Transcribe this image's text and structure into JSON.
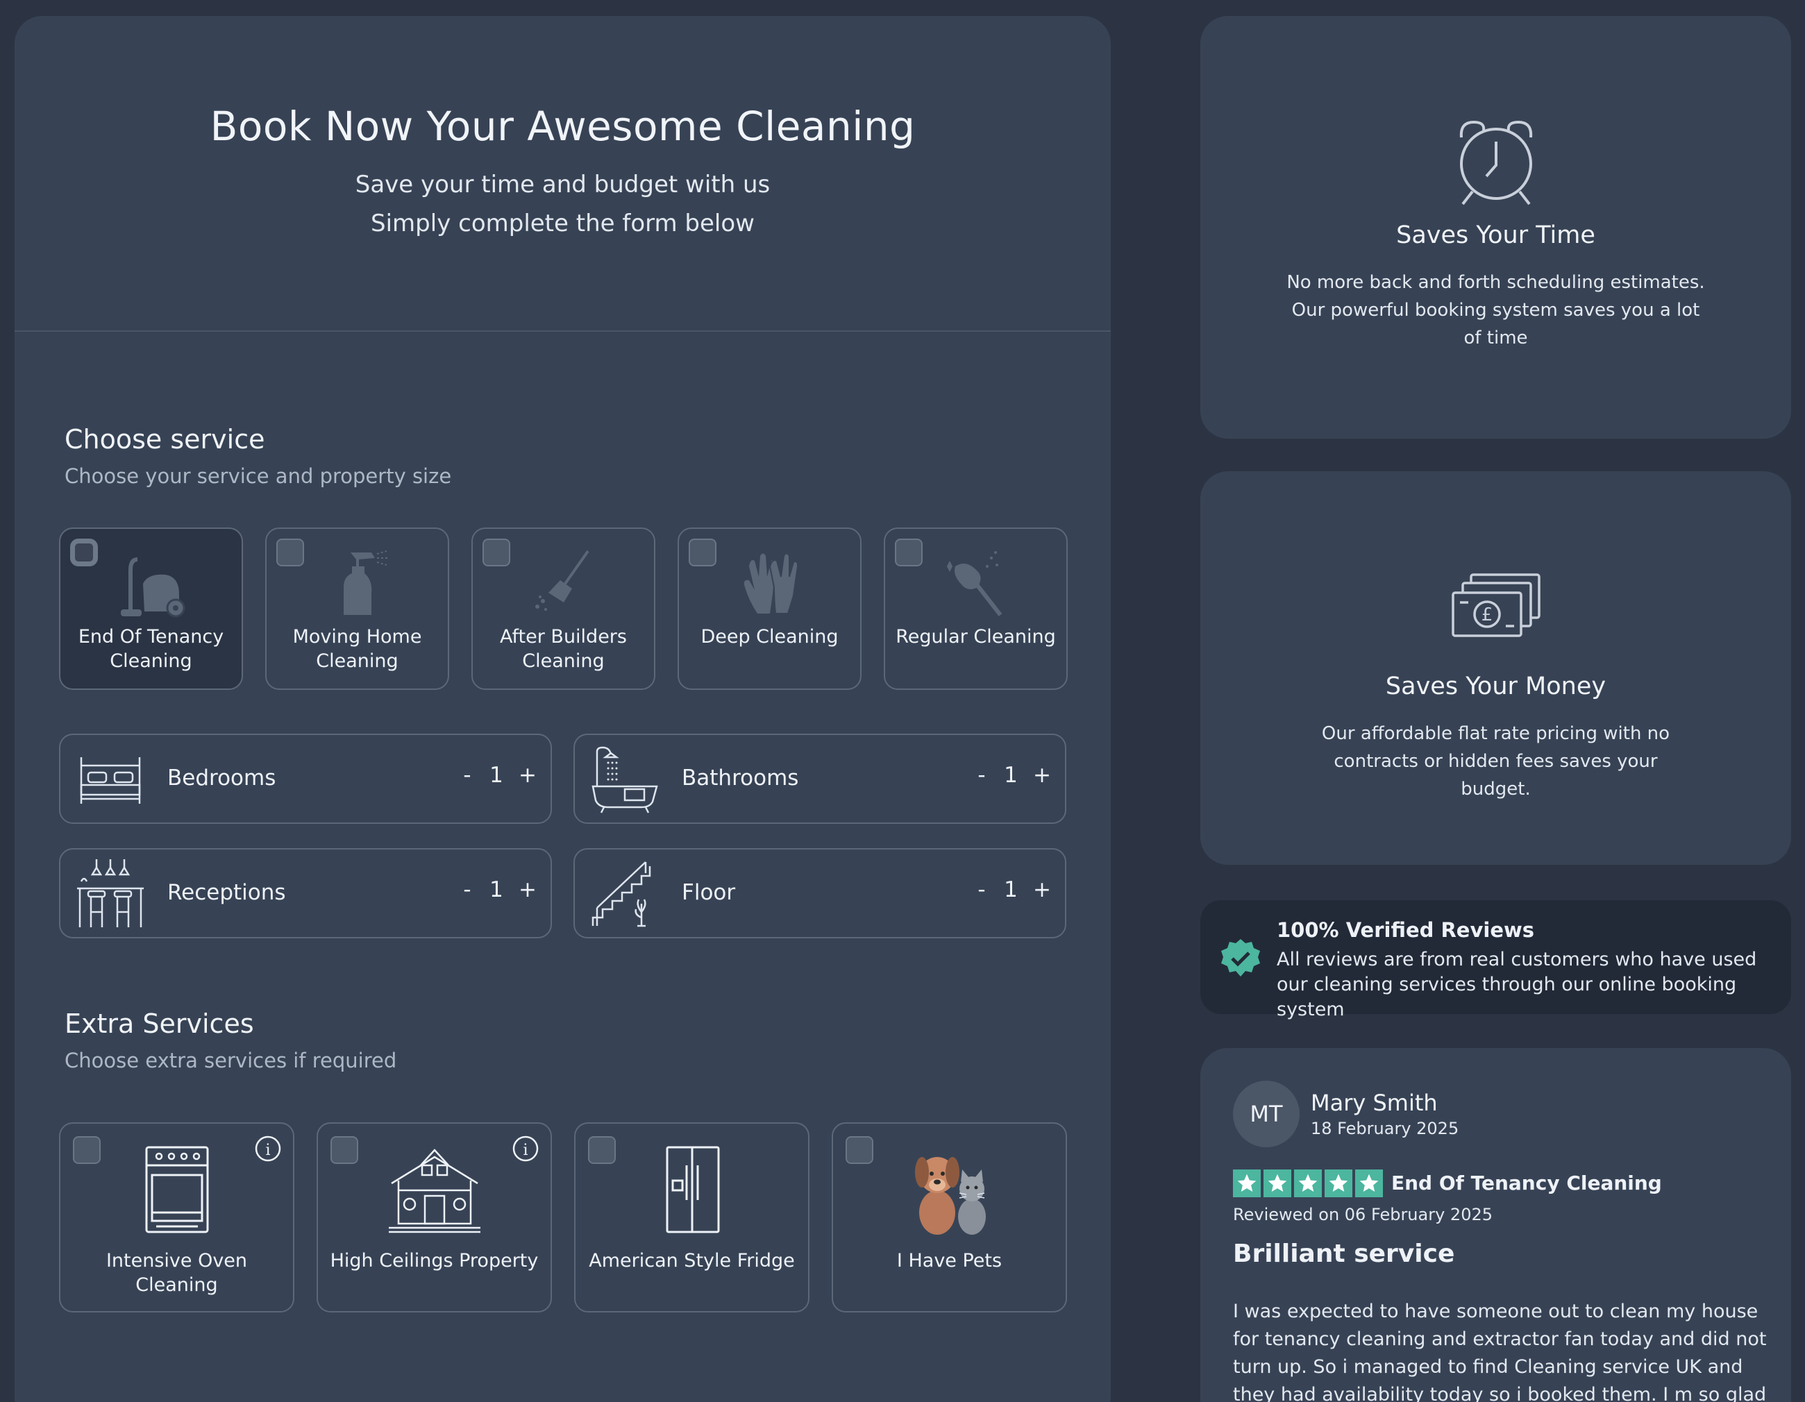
{
  "header": {
    "title": "Book Now Your Awesome Cleaning",
    "subtitle_line1": "Save your time and budget with us",
    "subtitle_line2": "Simply complete the form below"
  },
  "choose_service": {
    "title": "Choose service",
    "subtitle": "Choose your service and property size",
    "services": [
      {
        "label": "End Of Tenancy Cleaning",
        "icon": "vacuum-cleaner-icon",
        "selected": true
      },
      {
        "label": "Moving Home Cleaning",
        "icon": "spray-bottle-icon",
        "selected": false
      },
      {
        "label": "After Builders Cleaning",
        "icon": "broom-icon",
        "selected": false
      },
      {
        "label": "Deep Cleaning",
        "icon": "gloves-icon",
        "selected": false
      },
      {
        "label": "Regular Cleaning",
        "icon": "feather-duster-icon",
        "selected": false
      }
    ]
  },
  "rooms": [
    {
      "label": "Bedrooms",
      "value": "1",
      "minus": "-",
      "plus": "+",
      "icon": "bed-icon"
    },
    {
      "label": "Bathrooms",
      "value": "1",
      "minus": "-",
      "plus": "+",
      "icon": "bathtub-icon"
    },
    {
      "label": "Receptions",
      "value": "1",
      "minus": "-",
      "plus": "+",
      "icon": "bar-stools-icon"
    },
    {
      "label": "Floor",
      "value": "1",
      "minus": "-",
      "plus": "+",
      "icon": "stairs-icon"
    }
  ],
  "extra_services": {
    "title": "Extra Services",
    "subtitle": "Choose extra services if required",
    "items": [
      {
        "label": "Intensive Oven Cleaning",
        "icon": "oven-icon",
        "has_info": true
      },
      {
        "label": "High Ceilings Property",
        "icon": "house-icon",
        "has_info": true
      },
      {
        "label": "American Style Fridge",
        "icon": "fridge-icon",
        "has_info": false
      },
      {
        "label": "I Have Pets",
        "icon": "pets-icon",
        "has_info": false
      }
    ]
  },
  "benefits": [
    {
      "title": "Saves Your Time",
      "text": "No more back and forth scheduling estimates. Our powerful booking system saves you a lot of time",
      "icon": "alarm-clock-icon"
    },
    {
      "title": "Saves Your Money",
      "text": "Our affordable flat rate pricing with no contracts or hidden fees saves your budget.",
      "icon": "money-notes-icon"
    }
  ],
  "verified": {
    "title": "100% Verified Reviews",
    "text": "All reviews are from real customers who have used our cleaning services through our online booking system"
  },
  "review": {
    "initials": "MT",
    "name": "Mary Smith",
    "date": "18 February 2025",
    "rating": 5,
    "service": "End Of Tenancy Cleaning",
    "reviewed_on": "Reviewed on 06 February 2025",
    "title": "Brilliant service",
    "body": "I was expected to have someone out to clean my house for tenancy cleaning and extractor fan today and did not turn up. So i managed to find Cleaning service UK and they had availability today so i booked them. I m so glad i did."
  },
  "colors": {
    "background": "#2c3443",
    "panel": "#374355",
    "star_green": "#4cb69f",
    "verified_badge": "#4cb69f"
  }
}
